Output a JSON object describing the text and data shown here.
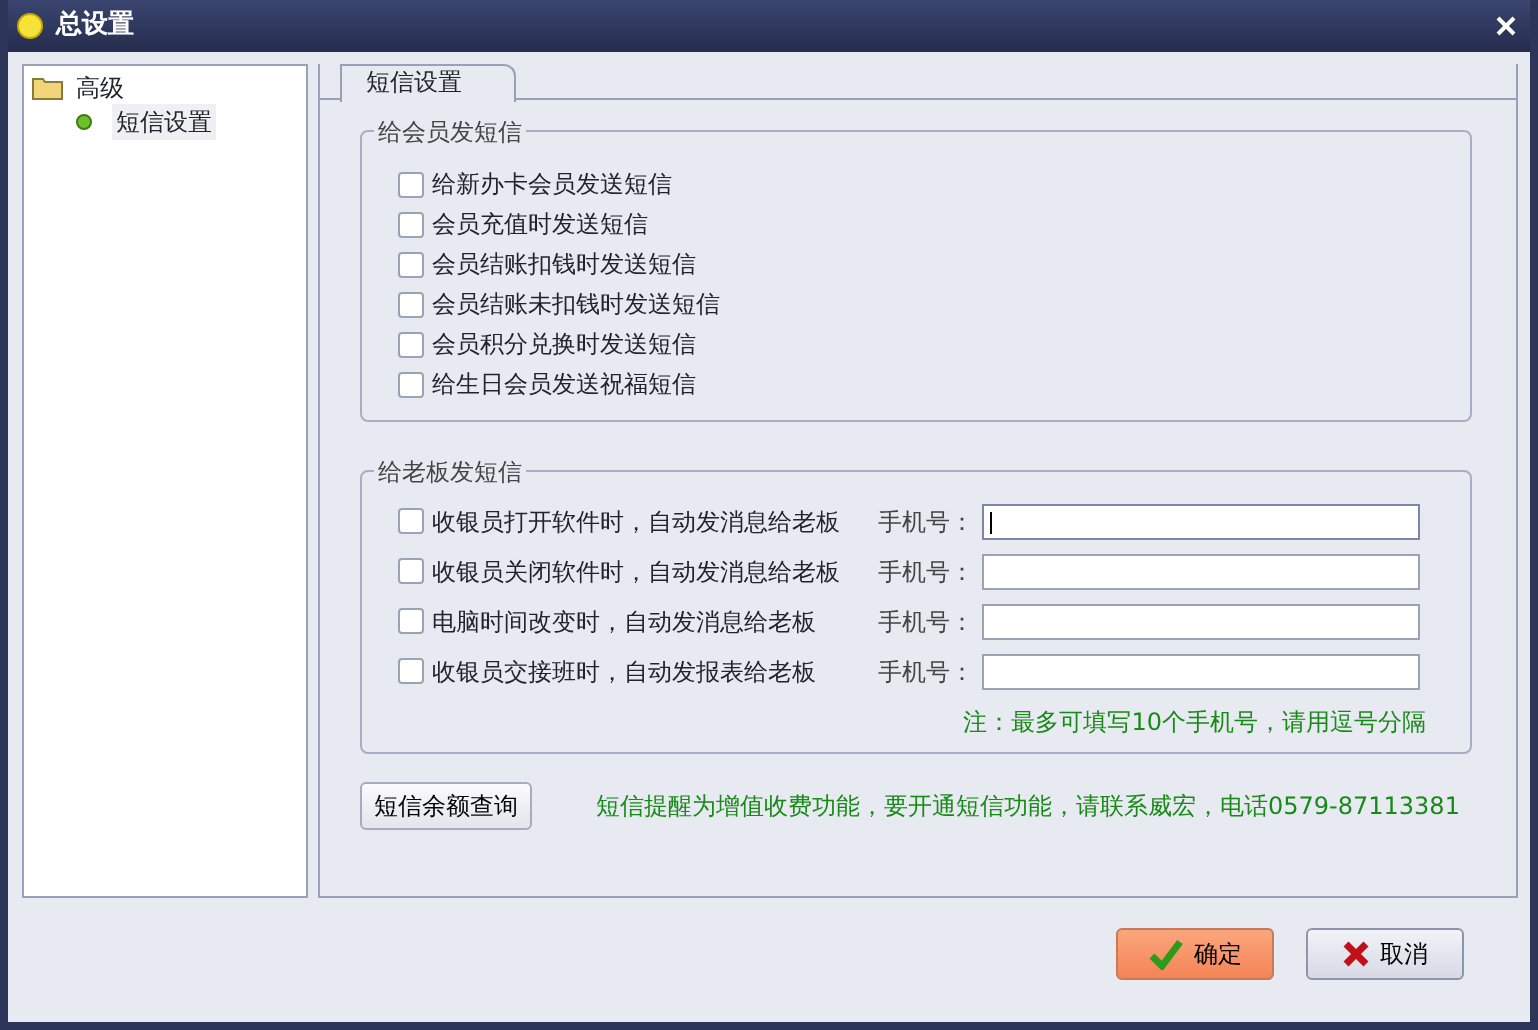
{
  "window": {
    "title": "总设置"
  },
  "tree": [
    {
      "label": "高级",
      "children": [
        {
          "label": "短信设置",
          "selected": true
        }
      ]
    }
  ],
  "tabs": [
    {
      "label": "短信设置",
      "selected": true
    }
  ],
  "member_group": {
    "title": "给会员发短信",
    "options": [
      {
        "label": "给新办卡会员发送短信",
        "checked": false
      },
      {
        "label": "会员充值时发送短信",
        "checked": false
      },
      {
        "label": "会员结账扣钱时发送短信",
        "checked": false
      },
      {
        "label": "会员结账未扣钱时发送短信",
        "checked": false
      },
      {
        "label": "会员积分兑换时发送短信",
        "checked": false
      },
      {
        "label": "给生日会员发送祝福短信",
        "checked": false
      }
    ]
  },
  "boss_group": {
    "title": "给老板发短信",
    "rows": [
      {
        "label": "收银员打开软件时，自动发消息给老板",
        "checked": false,
        "phone_label": "手机号：",
        "focused": true
      },
      {
        "label": "收银员关闭软件时，自动发消息给老板",
        "checked": false,
        "phone_label": "手机号：",
        "focused": false
      },
      {
        "label": "电脑时间改变时，自动发消息给老板",
        "checked": false,
        "phone_label": "手机号：",
        "focused": false
      },
      {
        "label": "收银员交接班时，自动发报表给老板",
        "checked": false,
        "phone_label": "手机号：",
        "focused": false
      }
    ],
    "note": "注：最多可填写10个手机号，请用逗号分隔"
  },
  "query_button": "短信余额查询",
  "notice": "短信提醒为增值收费功能，要开通短信功能，请联系威宏，电话0579-87113381",
  "buttons": [
    {
      "label": "确定",
      "kind": "ok"
    },
    {
      "label": "取消",
      "kind": "cancel"
    }
  ]
}
